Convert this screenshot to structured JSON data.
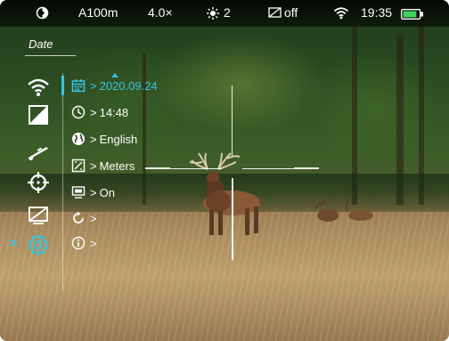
{
  "status_bar": {
    "mode_icon": "ir-palette-icon",
    "profile": "A100m",
    "zoom": "4.0×",
    "brightness_icon": "brightness-icon",
    "brightness": "2",
    "display_icon": "display-off-icon",
    "display_state": "off",
    "wifi_icon": "wifi-icon",
    "time": "19:35",
    "battery_icon": "battery-icon",
    "battery_level": 0.85,
    "accent_color": "#39c3e0"
  },
  "menu": {
    "header": "Date",
    "icons": [
      {
        "name": "wifi-menu-icon"
      },
      {
        "name": "calibration-menu-icon"
      },
      {
        "name": "rifle-menu-icon"
      },
      {
        "name": "zeroing-menu-icon"
      },
      {
        "name": "display-off-menu-icon"
      },
      {
        "name": "settings-menu-icon"
      }
    ],
    "selected_index": 5,
    "cursor": ">"
  },
  "submenu": {
    "rows": [
      {
        "icon": "calendar-icon",
        "value": "2020.09.24",
        "active": true
      },
      {
        "icon": "clock-icon",
        "value": "14:48",
        "active": false
      },
      {
        "icon": "globe-icon",
        "value": "English",
        "active": false
      },
      {
        "icon": "unit-icon",
        "value": "Meters",
        "active": false
      },
      {
        "icon": "screen-icon",
        "value": "On",
        "active": false
      },
      {
        "icon": "reset-icon",
        "value": "",
        "active": false
      },
      {
        "icon": "info-icon",
        "value": "",
        "active": false
      }
    ],
    "arrow": ">"
  },
  "colors": {
    "accent": "#39c3e0",
    "battery": "#3ed35a"
  }
}
